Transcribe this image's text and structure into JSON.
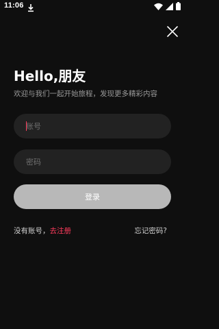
{
  "status_bar": {
    "time": "11:06",
    "icons": [
      "download-icon",
      "wifi-icon",
      "signal-icon",
      "battery-icon"
    ]
  },
  "header": {
    "close_icon": "close-icon"
  },
  "greeting": {
    "title": "Hello,朋友",
    "subtitle": "欢迎与我们一起开始旅程，发现更多精彩内容"
  },
  "form": {
    "account_placeholder": "账号",
    "account_value": "",
    "password_placeholder": "密码",
    "password_value": "",
    "login_label": "登录"
  },
  "footer": {
    "no_account_text": "没有账号，",
    "register_label": "去注册",
    "forgot_password_label": "忘记密码?"
  },
  "colors": {
    "background": "#0f0f0f",
    "field_background": "#222222",
    "login_button": "#b8b8b8",
    "accent": "#ff3b5c",
    "subtitle_text": "#9a9a9a"
  }
}
